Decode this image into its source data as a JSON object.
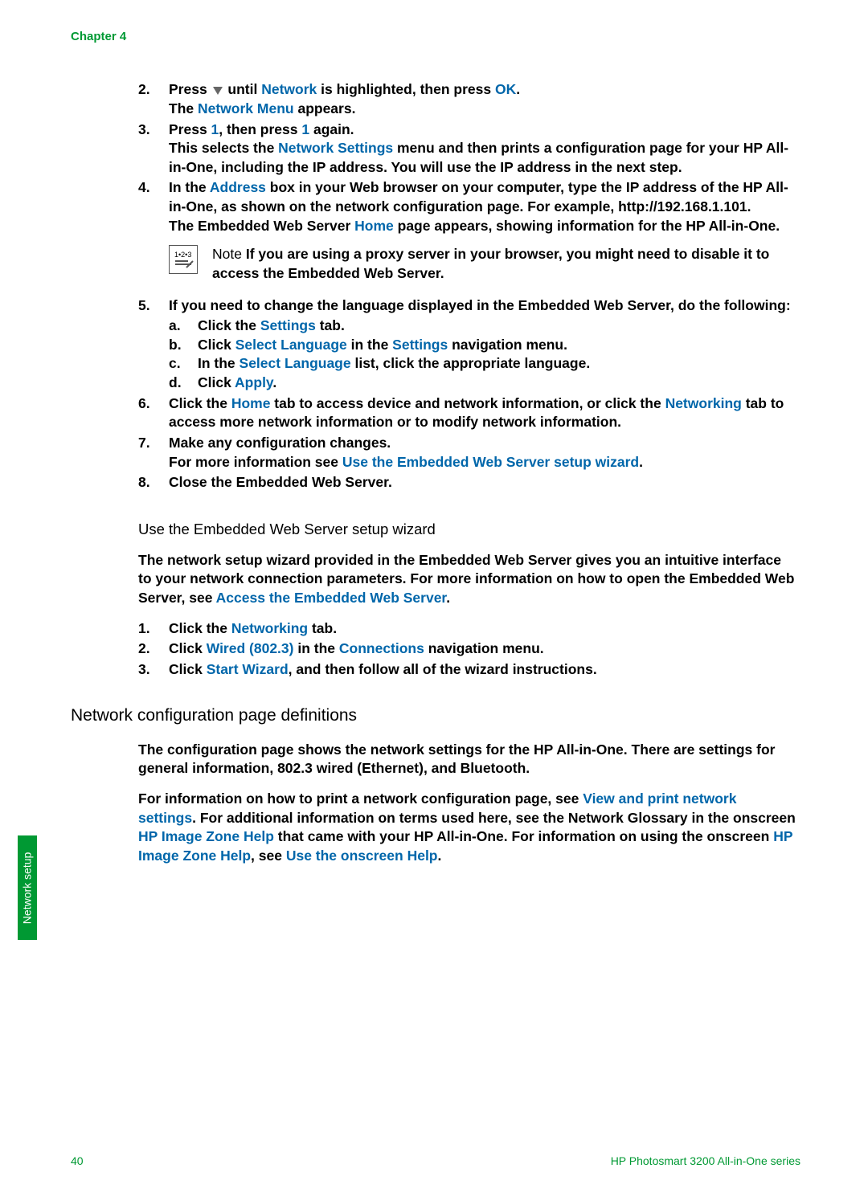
{
  "chapter": "Chapter 4",
  "side_tab": "Network setup",
  "steps_a": [
    {
      "n": "2.",
      "l1": [
        "Press ",
        "▼-icon",
        " until ",
        {
          "blue": "Network"
        },
        " is highlighted, then press ",
        {
          "blue": "OK"
        },
        "."
      ],
      "l2": [
        "The ",
        {
          "blue": "Network Menu"
        },
        " appears."
      ]
    },
    {
      "n": "3.",
      "l1": [
        "Press ",
        {
          "blue": "1"
        },
        ", then press ",
        {
          "blue": "1"
        },
        " again."
      ],
      "l2": [
        "This selects the ",
        {
          "blue": "Network Settings"
        },
        " menu and then prints a configuration page for your HP All-in-One, including the IP address. You will use the IP address in the next step."
      ]
    },
    {
      "n": "4.",
      "l1": [
        "In the ",
        {
          "blue": "Address"
        },
        " box in your Web browser on your computer, type the IP address of the HP All-in-One, as shown on the network configuration page. For example, http://192.168.1.101."
      ],
      "l2": [
        "The Embedded Web Server ",
        {
          "blue": "Home"
        },
        " page appears, showing information for the HP All-in-One."
      ],
      "note": {
        "label": "Note",
        "text": "If you are using a proxy server in your browser, you might need to disable it to access the Embedded Web Server."
      }
    },
    {
      "n": "5.",
      "l1": [
        "If you need to change the language displayed in the Embedded Web Server, do the following:"
      ],
      "sub": [
        {
          "k": "a.",
          "parts": [
            "Click the ",
            {
              "blue": "Settings"
            },
            " tab."
          ]
        },
        {
          "k": "b.",
          "parts": [
            "Click ",
            {
              "blue": "Select Language"
            },
            " in the ",
            {
              "blue": "Settings"
            },
            " navigation menu."
          ]
        },
        {
          "k": "c.",
          "parts": [
            "In the ",
            {
              "blue": "Select Language"
            },
            " list, click the appropriate language."
          ]
        },
        {
          "k": "d.",
          "parts": [
            "Click ",
            {
              "blue": "Apply"
            },
            "."
          ]
        }
      ]
    },
    {
      "n": "6.",
      "l1": [
        "Click the ",
        {
          "blue": "Home"
        },
        " tab to access device and network information, or click the ",
        {
          "blue": "Networking"
        },
        " tab to access more network information or to modify network information."
      ]
    },
    {
      "n": "7.",
      "l1": [
        "Make any configuration changes."
      ],
      "l2": [
        "For more information see ",
        {
          "blue": "Use the Embedded Web Server setup wizard"
        },
        "."
      ]
    },
    {
      "n": "8.",
      "l1": [
        "Close the Embedded Web Server."
      ]
    }
  ],
  "h2": "Use the Embedded Web Server setup wizard",
  "para1": [
    "The network setup wizard provided in the Embedded Web Server gives you an intuitive interface to your network connection parameters. For more information on how to open the Embedded Web Server, see ",
    {
      "blue": "Access the Embedded Web Server"
    },
    "."
  ],
  "steps_b": [
    {
      "n": "1.",
      "parts": [
        "Click the ",
        {
          "blue": "Networking"
        },
        " tab."
      ]
    },
    {
      "n": "2.",
      "parts": [
        "Click ",
        {
          "blue": "Wired (802.3)"
        },
        " in the ",
        {
          "blue": "Connections"
        },
        " navigation menu."
      ]
    },
    {
      "n": "3.",
      "parts": [
        "Click ",
        {
          "blue": "Start Wizard"
        },
        ", and then follow all of the wizard instructions."
      ]
    }
  ],
  "h1": "Network configuration page definitions",
  "para2": "The configuration page shows the network settings for the HP All-in-One. There are settings for general information, 802.3 wired (Ethernet), and Bluetooth.",
  "para3": [
    "For information on how to print a network configuration page, see ",
    {
      "blue": "View and print network settings"
    },
    ". For additional information on terms used here, see the Network Glossary in the onscreen ",
    {
      "blue": "HP Image Zone Help"
    },
    " that came with your HP All-in-One. For information on using the onscreen ",
    {
      "blue": "HP Image Zone Help"
    },
    ", see ",
    {
      "blue": "Use the onscreen Help"
    },
    "."
  ],
  "footer": {
    "page": "40",
    "product": "HP Photosmart 3200 All-in-One series"
  }
}
